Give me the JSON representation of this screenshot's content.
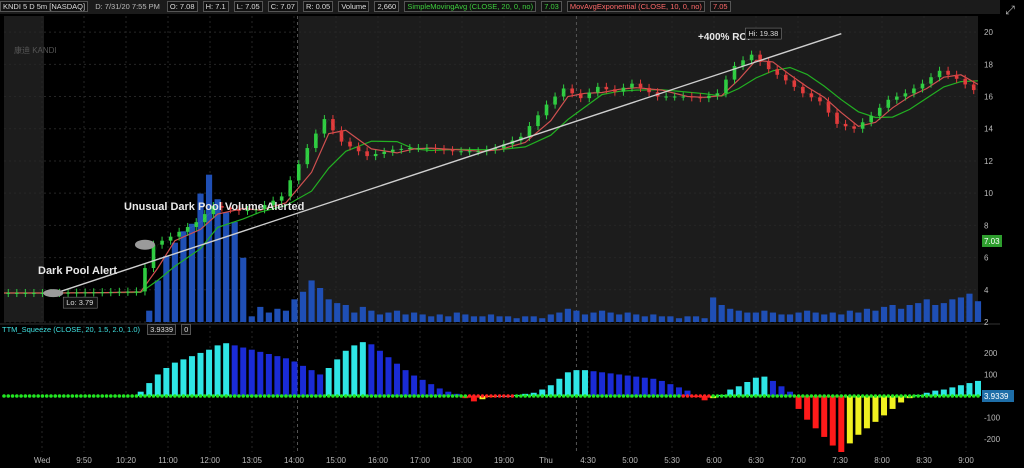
{
  "header": {
    "symbol_label": "KNDI 5 D 5m [NASDAQ]",
    "date_label": "D: 7/31/20 7:55 PM",
    "open_label": "O: 7.08",
    "high_label": "H: 7.1",
    "low_label": "L: 7.05",
    "close_label": "C: 7.07",
    "range_label": "R: 0.05",
    "volume_label": "Volume",
    "volume_value": "2,660",
    "sma_label": "SimpleMovingAvg (CLOSE, 20, 0, no)",
    "sma_value": "7.03",
    "ema_label": "MovAvgExponential (CLOSE, 10, 0, no)",
    "ema_value": "7.05"
  },
  "squeeze_header": {
    "label": "TTM_Squeeze (CLOSE, 20, 1.5, 2.0, 1.0)",
    "value": "3.9339",
    "extra": "0"
  },
  "watermark": "康迪 KANDI",
  "annotations": {
    "dark_pool_alert": "Dark Pool Alert",
    "unusual_volume": "Unusual Dark Pool Volume Alerted",
    "roi": "+400% ROI",
    "low_label": "Lo: 3.79",
    "high_label": "Hi: 19.38",
    "last_price_tag": "7.03",
    "squeeze_tag": "3.9339"
  },
  "colors": {
    "background": "#000000",
    "after_hours_background": "#1c1c1c",
    "candle_up": "#2ecc40",
    "candle_down": "#e03a3a",
    "sma": "#22b022",
    "ema": "#d05050",
    "volume": "#1f4fb5",
    "squeeze_cyan": "#2fe6e6",
    "squeeze_blue": "#1a2bd6",
    "squeeze_red": "#ff1a1a",
    "squeeze_yellow": "#f0f020",
    "squeeze_dot_green": "#22e622",
    "squeeze_dot_red": "#ff2222",
    "last_tag": "#2e9e2e"
  },
  "chart_data": [
    {
      "type": "line",
      "title": "KNDI 5 D 5m [NASDAQ]",
      "xlabel": "",
      "ylabel": "",
      "ylim": [
        2,
        21
      ],
      "grid": true,
      "y_tick_labels": [
        "2",
        "4",
        "6",
        "8",
        "10",
        "12",
        "14",
        "16",
        "18",
        "20"
      ],
      "x_tick_labels": [
        "Wed",
        "9:50",
        "10:20",
        "11:00",
        "12:00",
        "13:05",
        "14:00",
        "15:00",
        "16:00",
        "17:00",
        "18:00",
        "19:00",
        "Thu",
        "4:30",
        "5:00",
        "5:30",
        "6:00",
        "6:30",
        "7:00",
        "7:30",
        "8:00",
        "8:30",
        "9:00"
      ],
      "price_series": {
        "name": "Close",
        "x": [
          0,
          6,
          12,
          16,
          18,
          20,
          23,
          25,
          28,
          30,
          33,
          36,
          38,
          40,
          43,
          46,
          48,
          50,
          53,
          56,
          58,
          61,
          64,
          66,
          68,
          70,
          72,
          74,
          77,
          80,
          82,
          84,
          86,
          88,
          90,
          92,
          94,
          96,
          98,
          100,
          102,
          104,
          106,
          108,
          110,
          112,
          114
        ],
        "close": [
          3.8,
          3.8,
          3.85,
          3.9,
          6.8,
          7.3,
          8.2,
          9.2,
          8.9,
          9.0,
          9.8,
          12.8,
          14.6,
          13.2,
          12.3,
          12.7,
          12.8,
          12.8,
          12.6,
          12.6,
          12.8,
          13.5,
          15.5,
          16.5,
          15.9,
          16.6,
          16.3,
          16.8,
          16.0,
          16.0,
          15.9,
          16.2,
          17.9,
          18.6,
          17.7,
          17.0,
          16.2,
          15.7,
          14.3,
          14.0,
          14.8,
          15.8,
          16.2,
          16.8,
          17.6,
          17.1,
          16.4
        ]
      },
      "volume_series": {
        "name": "Volume",
        "x": [
          17,
          18,
          19,
          20,
          21,
          22,
          23,
          24,
          25,
          26,
          27,
          28,
          29,
          30,
          31,
          32,
          33,
          34,
          35,
          36,
          37,
          38,
          39,
          40,
          41,
          42,
          43,
          44,
          45,
          46,
          47,
          48,
          49,
          50,
          51,
          52,
          53,
          54,
          55,
          56,
          57,
          58,
          59,
          60,
          61,
          62,
          63,
          64,
          65,
          66,
          67,
          68,
          69,
          70,
          71,
          72,
          73,
          74,
          75,
          76,
          77,
          78,
          79,
          80,
          81,
          82,
          83,
          84,
          85,
          86,
          87,
          88,
          89,
          90,
          91,
          92,
          93,
          94,
          95,
          96,
          97,
          98,
          99,
          100,
          101,
          102,
          103,
          104,
          105,
          106,
          107,
          108,
          109,
          110,
          111,
          112,
          113,
          114
        ],
        "values": [
          0.6,
          2.2,
          3.5,
          4.2,
          4.8,
          5.2,
          6.8,
          7.8,
          6.5,
          5.8,
          5.3,
          3.4,
          0.3,
          0.8,
          0.5,
          0.7,
          0.6,
          1.2,
          1.6,
          2.2,
          1.8,
          1.2,
          1.0,
          0.9,
          0.5,
          0.8,
          0.6,
          0.4,
          0.5,
          0.6,
          0.4,
          0.5,
          0.4,
          0.3,
          0.4,
          0.3,
          0.5,
          0.4,
          0.3,
          0.3,
          0.4,
          0.3,
          0.3,
          0.2,
          0.3,
          0.3,
          0.2,
          0.4,
          0.5,
          0.7,
          0.6,
          0.4,
          0.5,
          0.6,
          0.5,
          0.4,
          0.5,
          0.4,
          0.3,
          0.4,
          0.3,
          0.3,
          0.2,
          0.3,
          0.3,
          0.2,
          1.3,
          0.9,
          0.7,
          0.6,
          0.5,
          0.5,
          0.6,
          0.5,
          0.4,
          0.4,
          0.5,
          0.6,
          0.5,
          0.4,
          0.5,
          0.4,
          0.6,
          0.5,
          0.7,
          0.6,
          0.8,
          0.9,
          0.7,
          0.9,
          1.0,
          1.2,
          0.9,
          1.0,
          1.2,
          1.3,
          1.5,
          1.1
        ]
      },
      "trendline": {
        "x": [
          6,
          98
        ],
        "y": [
          3.79,
          19.9
        ]
      },
      "low_marker": {
        "x": 6,
        "y": 3.79
      },
      "high_marker": {
        "x": 87,
        "y": 19.38
      },
      "last_price": 7.03
    },
    {
      "type": "bar",
      "title": "TTM_Squeeze (CLOSE, 20, 1.5, 2.0, 1.0)",
      "ylim": [
        -260,
        260
      ],
      "y_tick_labels": [
        "-200",
        "-100",
        "0",
        "100",
        "200"
      ],
      "x": [
        16,
        17,
        18,
        19,
        20,
        21,
        22,
        23,
        24,
        25,
        26,
        27,
        28,
        29,
        30,
        31,
        32,
        33,
        34,
        35,
        36,
        37,
        38,
        39,
        40,
        41,
        42,
        43,
        44,
        45,
        46,
        47,
        48,
        49,
        50,
        51,
        52,
        53,
        54,
        55,
        56,
        57,
        58,
        59,
        60,
        61,
        62,
        63,
        64,
        65,
        66,
        67,
        68,
        69,
        70,
        71,
        72,
        73,
        74,
        75,
        76,
        77,
        78,
        79,
        80,
        81,
        82,
        83,
        84,
        85,
        86,
        87,
        88,
        89,
        90,
        91,
        92,
        93,
        94,
        95,
        96,
        97,
        98,
        99,
        100,
        101,
        102,
        103,
        104,
        105,
        106,
        107,
        108,
        109,
        110,
        111,
        112,
        113,
        114
      ],
      "values": [
        20,
        60,
        100,
        130,
        155,
        170,
        185,
        200,
        215,
        235,
        245,
        235,
        225,
        215,
        205,
        195,
        185,
        175,
        160,
        140,
        120,
        100,
        130,
        170,
        210,
        235,
        250,
        240,
        210,
        180,
        150,
        120,
        95,
        75,
        55,
        35,
        20,
        10,
        -10,
        -25,
        -15,
        -5,
        0,
        0,
        5,
        10,
        15,
        30,
        50,
        80,
        110,
        120,
        120,
        115,
        110,
        105,
        100,
        95,
        90,
        85,
        80,
        70,
        55,
        40,
        25,
        -5,
        -20,
        -10,
        5,
        30,
        45,
        65,
        85,
        90,
        70,
        45,
        20,
        -60,
        -110,
        -150,
        -190,
        -230,
        -260,
        -220,
        -180,
        -150,
        -120,
        -90,
        -60,
        -30,
        -10,
        5,
        15,
        25,
        30,
        40,
        50,
        60,
        70
      ],
      "last_value": 3.9339
    }
  ]
}
